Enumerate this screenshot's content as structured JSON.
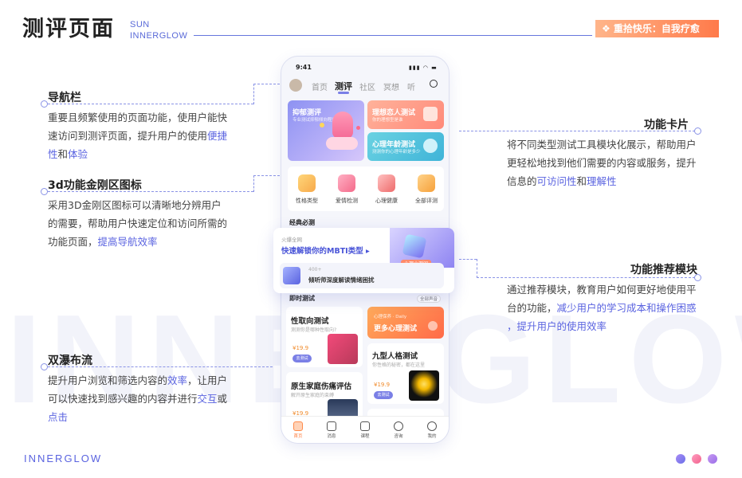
{
  "header": {
    "title": "测评页面",
    "sub1": "SUN",
    "sub2": "INNERGLOW",
    "badge": "❖ 重拾快乐：自我疗愈"
  },
  "watermark": "INNERGLOW",
  "footer": {
    "brand": "INNERGLOW"
  },
  "colors": {
    "accent": "#5a63e0",
    "badge": "#ff7a4a",
    "highlight": "#ffe25b",
    "dot1": "#8a7ff0",
    "dot2": "#f27aa8",
    "dot3": "#b07fe8"
  },
  "annotations": {
    "nav": {
      "title": "导航栏",
      "l1": "重要且频繁使用的页面功能，使用户能快",
      "l2a": "速访问到测评页面，提升用户的使用",
      "l2b": "便捷",
      "l3a": "性",
      "l3b": "和",
      "l3c": "体验"
    },
    "kingkong": {
      "title": "3d功能金刚区图标",
      "l1": "采用3D金刚区图标可以清晰地分辨用户",
      "l2": "的需要，帮助用户快速定位和访问所需的",
      "l3a": "功能页面，",
      "l3b": "提高导航效率"
    },
    "waterfall": {
      "title": "双瀑布流",
      "l1a": "提升用户浏览和筛选内容的",
      "l1b": "效率",
      "l1c": "，让用户",
      "l2a": "可以快速找到感兴趣的内容并进行",
      "l2b": "交互",
      "l2c": "或",
      "l3": "点击"
    },
    "cards": {
      "title": "功能卡片",
      "l1": "将不同类型测试工具模块化展示，帮助用户",
      "l2": "更轻松地找到他们需要的内容或服务，提升",
      "l3a": "信息的",
      "l3b": "可访问性",
      "l3c": "和",
      "l3d": "理解性"
    },
    "recommend": {
      "title": "功能推荐模块",
      "l1": "通过推荐模块，教育用户如何更好地使用平",
      "l2a": "台的功能，",
      "l2b": "减少用户的学习成本和操作困惑",
      "l3": "，提升用户的使用效率"
    }
  },
  "phone": {
    "time": "9:41",
    "tabs": [
      "首页",
      "测评",
      "社区",
      "冥想",
      "听"
    ],
    "cards": [
      {
        "title": "抑郁测评",
        "sub": "专业测试抑郁倾向程度"
      },
      {
        "title": "理想恋人测试",
        "sub": "你的理想型是谁"
      },
      {
        "title": "心理年龄测试",
        "sub": "测测你的心理年龄是多少"
      }
    ],
    "kingkong": [
      "性格类型",
      "爱情检测",
      "心理健康",
      "全部评测"
    ],
    "classic": {
      "title": "经典必测"
    },
    "promo": {
      "tag": "火爆全网",
      "title": "快速解锁你的MBTI类型 ▸",
      "count": "400+",
      "desc": "倾听师深度解读情绪困扰",
      "label": "心理小测间"
    },
    "instant": {
      "title": "即时测试",
      "all": "全部声音"
    },
    "feed": [
      {
        "title": "性取向测试",
        "sub": "测测你是哪种性取向?",
        "price": "¥19.9",
        "btn": "去测试"
      },
      {
        "title": "更多心理测试",
        "sub": "心理保养 · Daily"
      },
      {
        "title": "九型人格测试",
        "sub": "你性格的秘密，都在这里",
        "price": "¥19.9",
        "btn": "去测试"
      },
      {
        "title": "原生家庭伤痛评估",
        "sub": "解开原生家庭的束缚",
        "price": "¥19.9"
      }
    ],
    "nav": [
      "首页",
      "消息",
      "课程",
      "咨询",
      "我的"
    ]
  }
}
